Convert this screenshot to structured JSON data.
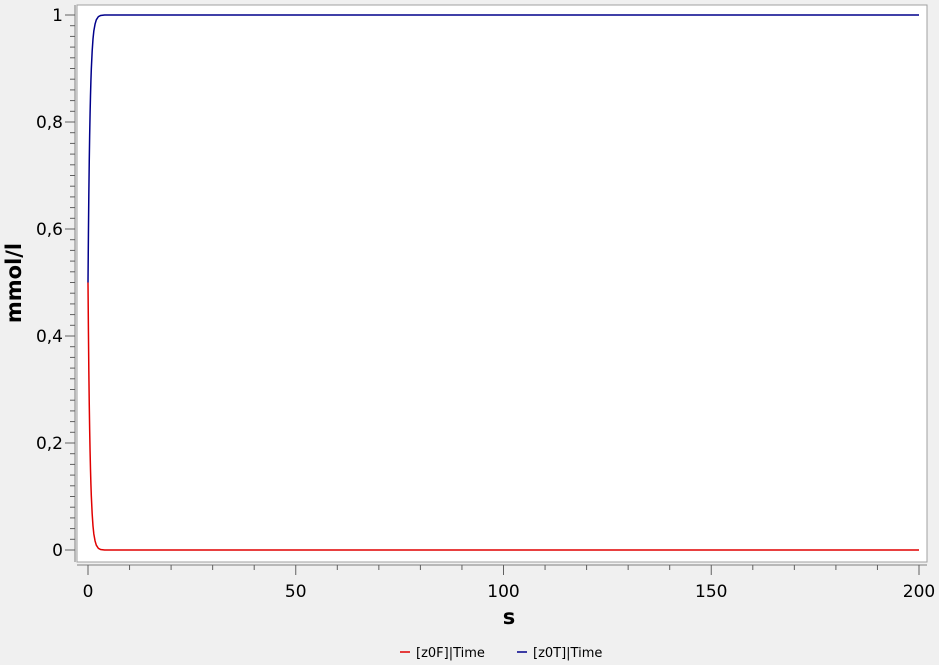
{
  "chart_data": {
    "type": "line",
    "xlabel": "s",
    "ylabel": "mmol/l",
    "xlim": [
      0,
      200
    ],
    "ylim": [
      0,
      1
    ],
    "x_ticks": [
      0,
      50,
      100,
      150,
      200
    ],
    "x_tick_labels": [
      "0",
      "50",
      "100",
      "150",
      "200"
    ],
    "y_ticks": [
      0,
      0.2,
      0.4,
      0.6,
      0.8,
      1
    ],
    "y_tick_labels": [
      "0",
      "0,2",
      "0,4",
      "0,6",
      "0,8",
      "1"
    ],
    "grid": false,
    "legend_position": "bottom",
    "series": [
      {
        "name": "[z0F]|Time",
        "color": "#e00000",
        "x": [
          0,
          0.1,
          0.2,
          0.3,
          0.4,
          0.5,
          0.6,
          0.7,
          0.8,
          1.0,
          1.2,
          1.4,
          1.7,
          2.0,
          2.5,
          3.0,
          4.0,
          5.0,
          10,
          50,
          100,
          150,
          200
        ],
        "y": [
          0.5,
          0.41,
          0.335,
          0.274,
          0.225,
          0.184,
          0.151,
          0.123,
          0.101,
          0.068,
          0.045,
          0.03,
          0.017,
          0.009,
          0.003,
          0.001,
          0.0,
          0.0,
          0.0,
          0.0,
          0.0,
          0.0,
          0.0
        ]
      },
      {
        "name": "[z0T]|Time",
        "color": "#00008b",
        "x": [
          0,
          0.1,
          0.2,
          0.3,
          0.4,
          0.5,
          0.6,
          0.7,
          0.8,
          1.0,
          1.2,
          1.4,
          1.7,
          2.0,
          2.5,
          3.0,
          4.0,
          5.0,
          10,
          50,
          100,
          150,
          200
        ],
        "y": [
          0.5,
          0.59,
          0.665,
          0.726,
          0.775,
          0.816,
          0.849,
          0.877,
          0.899,
          0.932,
          0.955,
          0.97,
          0.983,
          0.991,
          0.997,
          0.999,
          1.0,
          1.0,
          1.0,
          1.0,
          1.0,
          1.0,
          1.0
        ]
      }
    ]
  }
}
